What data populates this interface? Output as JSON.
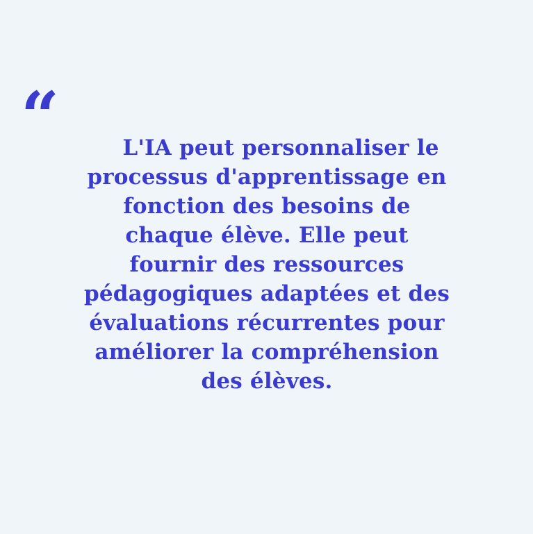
{
  "quote": {
    "mark": "“",
    "lines": [
      "L'IA peut personnaliser le",
      "processus d'apprentissage en",
      "fonction des besoins de",
      "chaque élève. Elle peut",
      "fournir des ressources",
      "pédagogiques adaptées et des",
      "évaluations récurrentes pour",
      "améliorer la compréhension",
      "des élèves."
    ]
  },
  "colors": {
    "background": "#f0f5f9",
    "text": "#3a3ccf"
  }
}
